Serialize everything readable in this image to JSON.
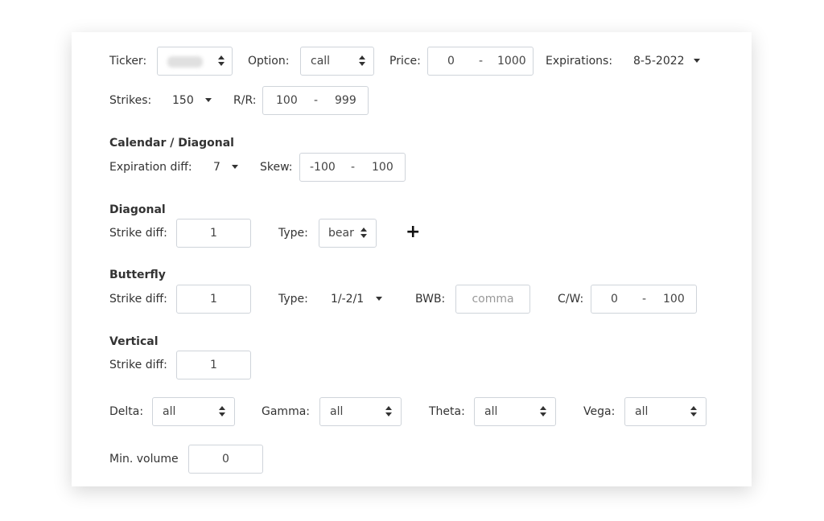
{
  "filters": {
    "ticker": {
      "label": "Ticker:"
    },
    "option": {
      "label": "Option:",
      "value": "call"
    },
    "price": {
      "label": "Price:",
      "min": "0",
      "sep": "-",
      "max": "1000"
    },
    "expirations": {
      "label": "Expirations:",
      "value": "8-5-2022"
    },
    "strikes": {
      "label": "Strikes:",
      "value": "150"
    },
    "rr": {
      "label": "R/R:",
      "min": "100",
      "sep": "-",
      "max": "999"
    }
  },
  "calendar": {
    "title": "Calendar / Diagonal",
    "expiration_diff": {
      "label": "Expiration diff:",
      "value": "7"
    },
    "skew": {
      "label": "Skew:",
      "min": "-100",
      "sep": "-",
      "max": "100"
    }
  },
  "diagonal": {
    "title": "Diagonal",
    "strike_diff": {
      "label": "Strike diff:",
      "value": "1"
    },
    "type": {
      "label": "Type:",
      "value": "bear"
    },
    "add": "+"
  },
  "butterfly": {
    "title": "Butterfly",
    "strike_diff": {
      "label": "Strike diff:",
      "value": "1"
    },
    "type": {
      "label": "Type:",
      "value": "1/-2/1"
    },
    "bwb": {
      "label": "BWB:",
      "placeholder": "comma"
    },
    "cw": {
      "label": "C/W:",
      "min": "0",
      "sep": "-",
      "max": "100"
    }
  },
  "vertical": {
    "title": "Vertical",
    "strike_diff": {
      "label": "Strike diff:",
      "value": "1"
    }
  },
  "greeks": {
    "delta": {
      "label": "Delta:",
      "value": "all"
    },
    "gamma": {
      "label": "Gamma:",
      "value": "all"
    },
    "theta": {
      "label": "Theta:",
      "value": "all"
    },
    "vega": {
      "label": "Vega:",
      "value": "all"
    }
  },
  "min_volume": {
    "label": "Min. volume",
    "value": "0"
  }
}
